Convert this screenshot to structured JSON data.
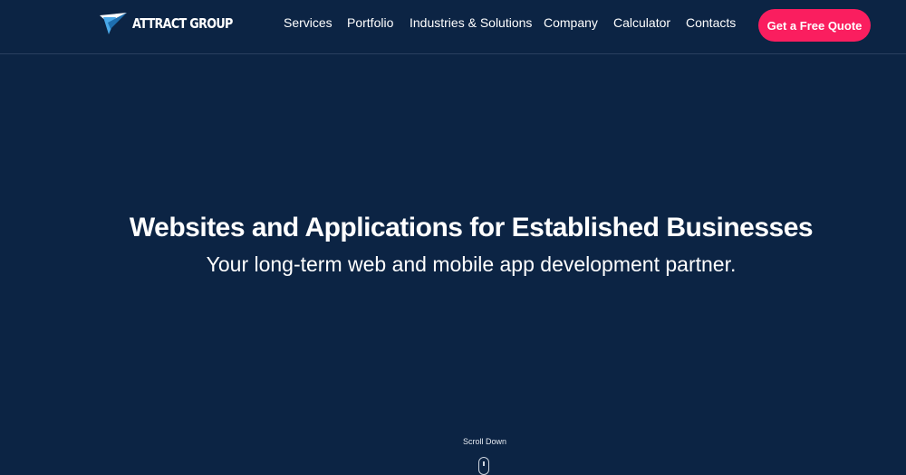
{
  "header": {
    "logo_text": "ATTRACT GROUP",
    "logo_icon": "paper-plane-icon",
    "nav": [
      {
        "label": "Services"
      },
      {
        "label": "Portfolio"
      },
      {
        "label": "Industries & Solutions"
      },
      {
        "label": "Company"
      },
      {
        "label": "Calculator"
      },
      {
        "label": "Contacts"
      }
    ],
    "cta_label": "Get a Free Quote"
  },
  "hero": {
    "title": "Websites and Applications for Established Businesses",
    "subtitle": "Your long-term web and mobile app development partner."
  },
  "scroll": {
    "label": "Scroll Down",
    "icon": "mouse-icon"
  },
  "colors": {
    "background": "#0c2444",
    "accent": "#fa1e5f",
    "logo_blue": "#4aa8e8"
  }
}
